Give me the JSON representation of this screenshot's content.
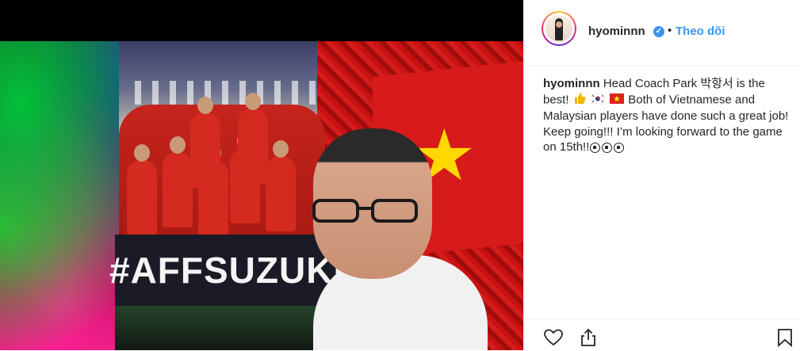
{
  "post": {
    "username": "hyominnn",
    "follow_label": "Theo dõi",
    "separator": "•",
    "caption_line1_before": "Head Coach Park 박항서 is the best!",
    "caption_line1_after": "Both of Vietnamese and Malaysian players have done such a great job!",
    "caption_line2": "Keep going!!! I’m looking forward to the game on 15th!!",
    "image_banner_text": "#AFFSUZUKIC"
  },
  "icons": {
    "verified": "verified-badge-icon",
    "like": "heart-icon",
    "share": "share-icon",
    "save": "bookmark-icon"
  },
  "colors": {
    "link_blue": "#3897f0",
    "text": "#262626",
    "divider": "#efefef"
  }
}
